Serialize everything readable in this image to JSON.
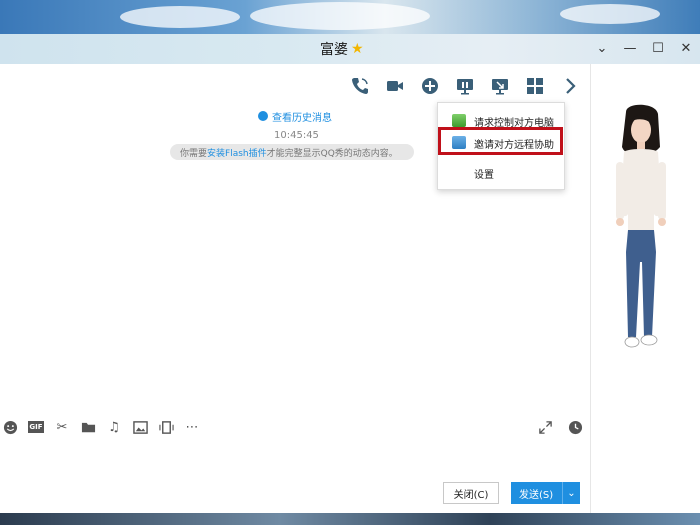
{
  "window": {
    "title": "富婆",
    "title_badge_icon": "star-icon"
  },
  "toolbar": {
    "icons": [
      "phone-icon",
      "video-icon",
      "add-icon",
      "screen-share-icon",
      "remote-desktop-icon",
      "apps-icon",
      "chevron-right-icon"
    ]
  },
  "chat": {
    "history_link": "查看历史消息",
    "timestamp": "10:45:45",
    "flash_notice_prefix": "你需要",
    "flash_notice_link": "安装Flash插件",
    "flash_notice_suffix": "才能完整显示QQ秀的动态内容。"
  },
  "dropdown": {
    "items": [
      {
        "label": "请求控制对方电脑",
        "icon": "remote-control-icon"
      },
      {
        "label": "邀请对方远程协助",
        "icon": "remote-assist-icon"
      },
      {
        "label": "设置",
        "icon": ""
      }
    ],
    "highlight_color": "#c0101a"
  },
  "input_toolbar": {
    "icons": [
      "emoji-icon",
      "gif-icon",
      "scissors-icon",
      "folder-icon",
      "music-icon",
      "image-icon",
      "phone-frame-icon",
      "more-icon"
    ],
    "gif_text": "GIF",
    "right_icons": [
      "expand-icon",
      "history-clock-icon"
    ]
  },
  "actions": {
    "close_label": "关闭(C)",
    "send_label": "发送(S)"
  },
  "colors": {
    "accent": "#1f8fe0",
    "titlebar": "#d8e9f1"
  }
}
